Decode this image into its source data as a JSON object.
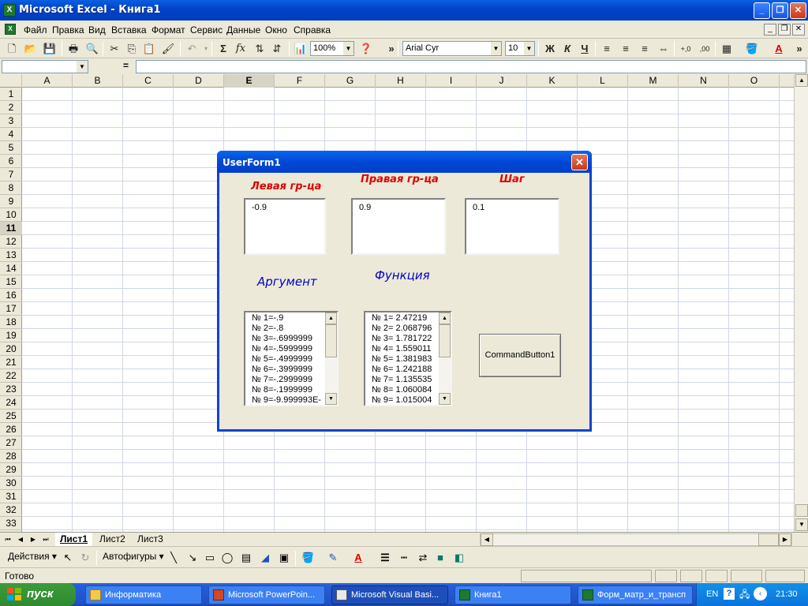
{
  "window": {
    "title": "Microsoft Excel - Книга1",
    "app_icon": "excel-icon",
    "min": "_",
    "restore": "❐",
    "close": "✕"
  },
  "menu": {
    "items": [
      "Файл",
      "Правка",
      "Вид",
      "Вставка",
      "Формат",
      "Сервис",
      "Данные",
      "Окно",
      "Справка"
    ]
  },
  "toolbar": {
    "zoom": "100%",
    "font": "Arial Cyr",
    "font_size": "10",
    "bold": "Ж",
    "italic": "К",
    "underline": "Ч",
    "sum": "Σ",
    "fx": "fx",
    "more": "»"
  },
  "formula_bar": {
    "name_box": "",
    "equals": "=",
    "content": ""
  },
  "grid": {
    "columns": [
      "A",
      "B",
      "C",
      "D",
      "E",
      "F",
      "G",
      "H",
      "I",
      "J",
      "K",
      "L",
      "M",
      "N",
      "O"
    ],
    "selected_column": "E",
    "rows": [
      "1",
      "2",
      "3",
      "4",
      "5",
      "6",
      "7",
      "8",
      "9",
      "10",
      "11",
      "12",
      "13",
      "14",
      "15",
      "16",
      "17",
      "18",
      "19",
      "20",
      "21",
      "22",
      "23",
      "24",
      "25",
      "26",
      "27",
      "28",
      "29",
      "30",
      "31",
      "32",
      "33"
    ],
    "selected_row": "11"
  },
  "sheets": {
    "tabs": [
      "Лист1",
      "Лист2",
      "Лист3"
    ],
    "active": "Лист1"
  },
  "drawing_toolbar": {
    "actions": "Действия",
    "autoshapes": "Автофигуры"
  },
  "status": {
    "text": "Готово"
  },
  "taskbar": {
    "start": "пуск",
    "tasks": [
      {
        "label": "Информатика",
        "icon": "folder-icon"
      },
      {
        "label": "Microsoft PowerPoin...",
        "icon": "powerpoint-icon"
      },
      {
        "label": "Microsoft Visual Basi...",
        "icon": "vba-icon"
      },
      {
        "label": "Книга1",
        "icon": "excel-icon"
      },
      {
        "label": "Форм_матр_и_трансп",
        "icon": "excel-icon"
      }
    ],
    "lang": "EN",
    "clock": "21:30"
  },
  "userform": {
    "title": "UserForm1",
    "left_label": "Левая гр-ца",
    "right_label": "Правая гр-ца",
    "step_label": "Шаг",
    "left_value": "-0.9",
    "right_value": "0.9",
    "step_value": "0.1",
    "argument_label": "Аргумент",
    "function_label": "Функция",
    "argument_list": [
      "№ 1=-.9",
      "№ 2=-.8",
      "№ 3=-.6999999",
      "№ 4=-.5999999",
      "№ 5=-.4999999",
      "№ 6=-.3999999",
      "№ 7=-.2999999",
      "№ 8=-.1999999",
      "№ 9=-9.999993E-"
    ],
    "function_list": [
      "№ 1= 2.47219",
      "№ 2= 2.068796",
      "№ 3= 1.781722",
      "№ 4= 1.559011",
      "№ 5= 1.381983",
      "№ 6= 1.242188",
      "№ 7= 1.135535",
      "№ 8= 1.060084",
      "№ 9= 1.015004"
    ],
    "button_label": "CommandButton1"
  },
  "colors": {
    "title_blue": "#0046d5",
    "label_red": "#e00000",
    "label_blue": "#0000cc",
    "taskbar_blue": "#245edb",
    "start_green": "#2f8a2f"
  }
}
